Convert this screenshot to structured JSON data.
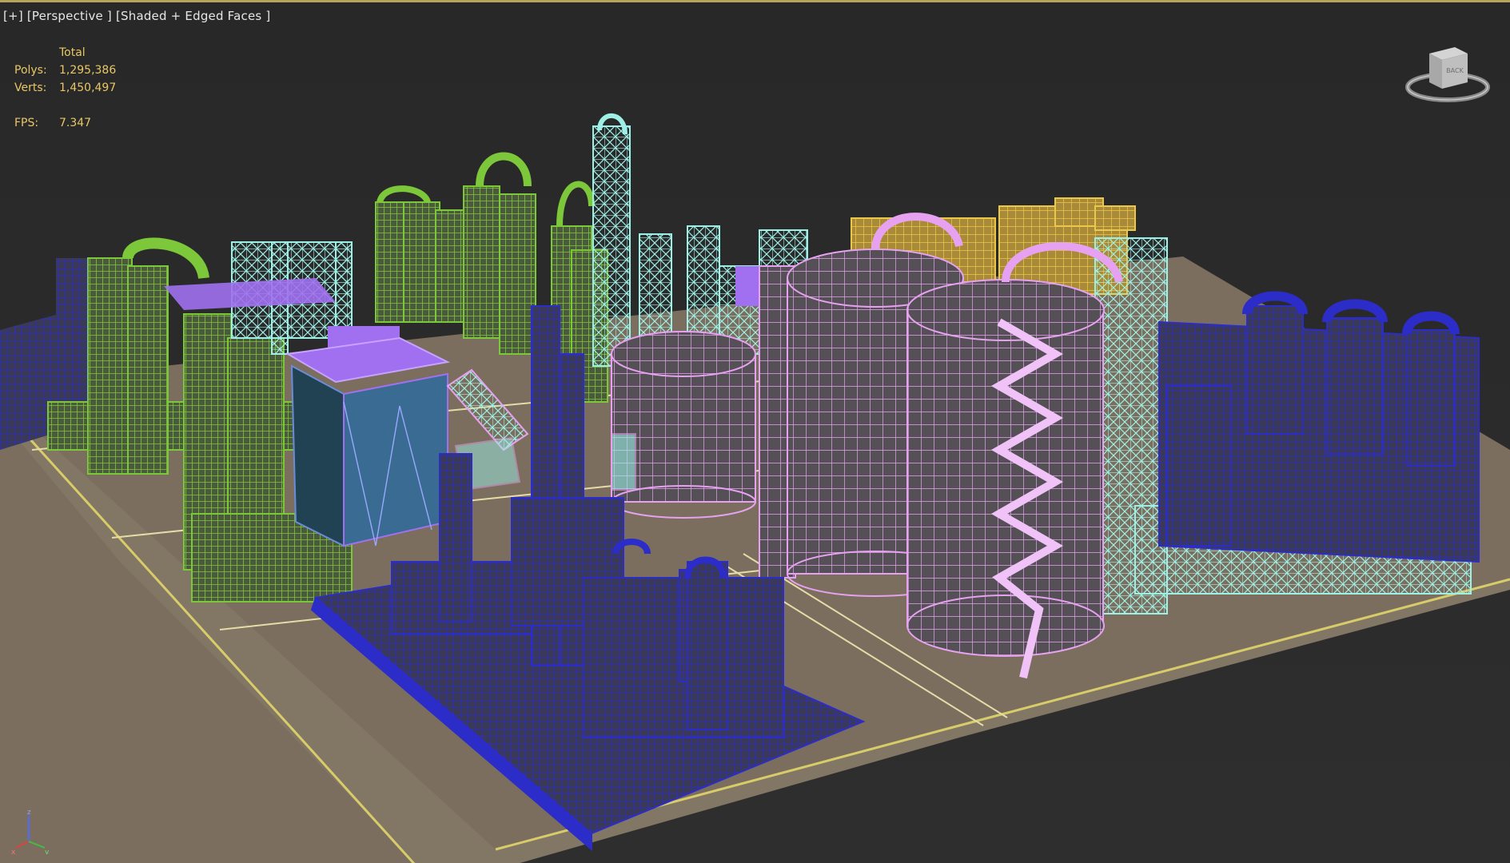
{
  "viewport": {
    "menu_plus": "[+]",
    "view_name": "[Perspective ]",
    "shading_mode": "[Shaded + Edged Faces ]"
  },
  "stats": {
    "header": "Total",
    "polys_label": "Polys:",
    "polys_value": "1,295,386",
    "verts_label": "Verts:",
    "verts_value": "1,450,497",
    "fps_label": "FPS:",
    "fps_value": "7.347"
  },
  "viewcube": {
    "face_label": "BACK"
  },
  "axis_gizmo": {
    "x_label": "x",
    "y_label": "y",
    "z_label": "z"
  },
  "colors": {
    "background": "#2b2b2b",
    "ground": "#7d6f5f",
    "ground_line": "#d8cc6a",
    "wire_green": "#7cc83a",
    "wire_cyan": "#9ef0e6",
    "wire_pink": "#e6a2f0",
    "wire_blue": "#2c2cb4",
    "wire_yellow": "#ecc84a",
    "wire_purple": "#a070f0",
    "stats_text": "#e8c766"
  }
}
